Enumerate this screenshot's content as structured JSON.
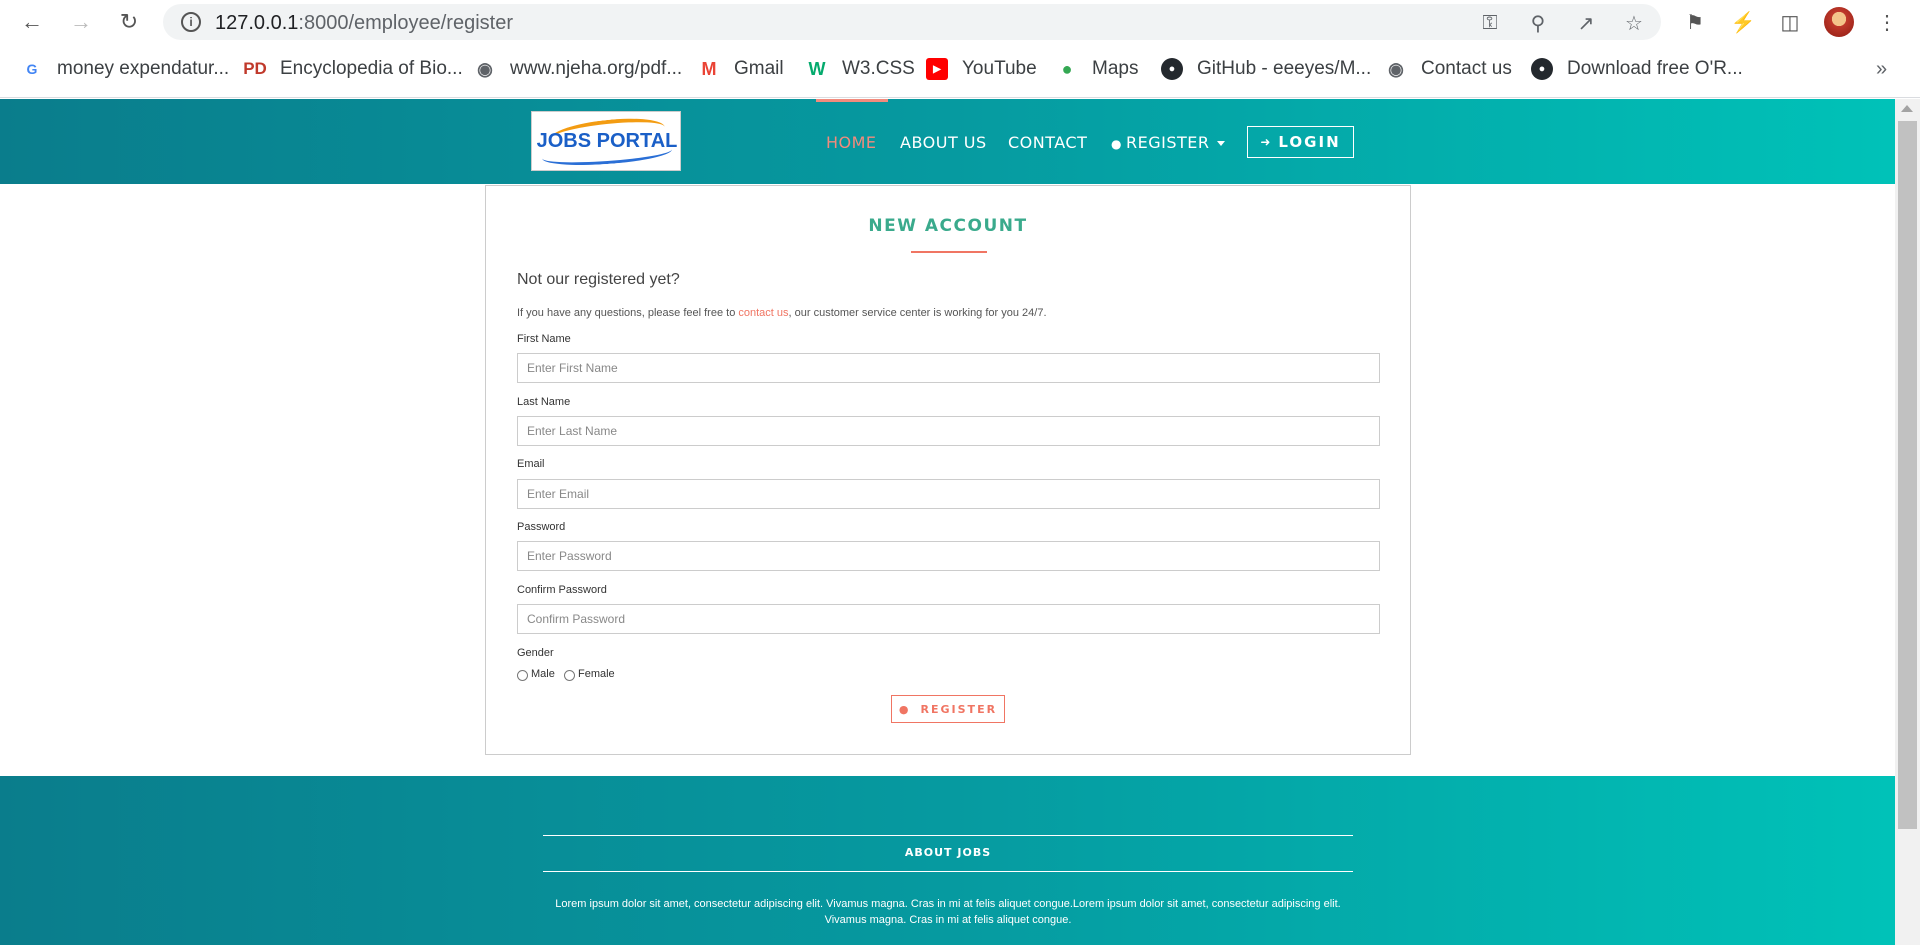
{
  "browser": {
    "url_host": "127.0.0.1",
    "url_path": ":8000/employee/register",
    "bookmarks": [
      {
        "label": "money expendatur...",
        "icon": "google-icon"
      },
      {
        "label": "Encyclopedia of Bio...",
        "icon": "pd-icon"
      },
      {
        "label": "www.njeha.org/pdf...",
        "icon": "globe-icon"
      },
      {
        "label": "Gmail",
        "icon": "gmail-icon"
      },
      {
        "label": "W3.CSS",
        "icon": "w3-icon"
      },
      {
        "label": "YouTube",
        "icon": "youtube-icon"
      },
      {
        "label": "Maps",
        "icon": "maps-icon"
      },
      {
        "label": "GitHub - eeeyes/M...",
        "icon": "github-icon"
      },
      {
        "label": "Contact us",
        "icon": "globe-icon"
      },
      {
        "label": "Download free O'R...",
        "icon": "github-icon"
      }
    ],
    "more_label": "»"
  },
  "header": {
    "logo_text": "JOBS PORTAL",
    "nav": {
      "home": "HOME",
      "about": "ABOUT US",
      "contact": "CONTACT",
      "register": "REGISTER",
      "login": "LOGIN"
    }
  },
  "form": {
    "title": "NEW ACCOUNT",
    "subtitle": "Not our registered yet?",
    "desc_before": "If you have any questions, please feel free to ",
    "desc_link": "contact us",
    "desc_after": ", our customer service center is working for you 24/7.",
    "fields": {
      "first_name": {
        "label": "First Name",
        "placeholder": "Enter First Name"
      },
      "last_name": {
        "label": "Last Name",
        "placeholder": "Enter Last Name"
      },
      "email": {
        "label": "Email",
        "placeholder": "Enter Email"
      },
      "password": {
        "label": "Password",
        "placeholder": "Enter Password"
      },
      "confirm_password": {
        "label": "Confirm Password",
        "placeholder": "Confirm Password"
      }
    },
    "gender": {
      "label": "Gender",
      "male": "Male",
      "female": "Female"
    },
    "submit": "REGISTER"
  },
  "footer": {
    "title": "ABOUT JOBS",
    "text": "Lorem ipsum dolor sit amet, consectetur adipiscing elit. Vivamus magna. Cras in mi at felis aliquet congue.Lorem ipsum dolor sit amet, consectetur adipiscing elit. Vivamus magna. Cras in mi at felis aliquet congue."
  },
  "colors": {
    "header_gradient_start": "#0a7d8c",
    "header_gradient_end": "#00c2b8",
    "accent": "#f07563",
    "title_green": "#3aaa8c"
  }
}
